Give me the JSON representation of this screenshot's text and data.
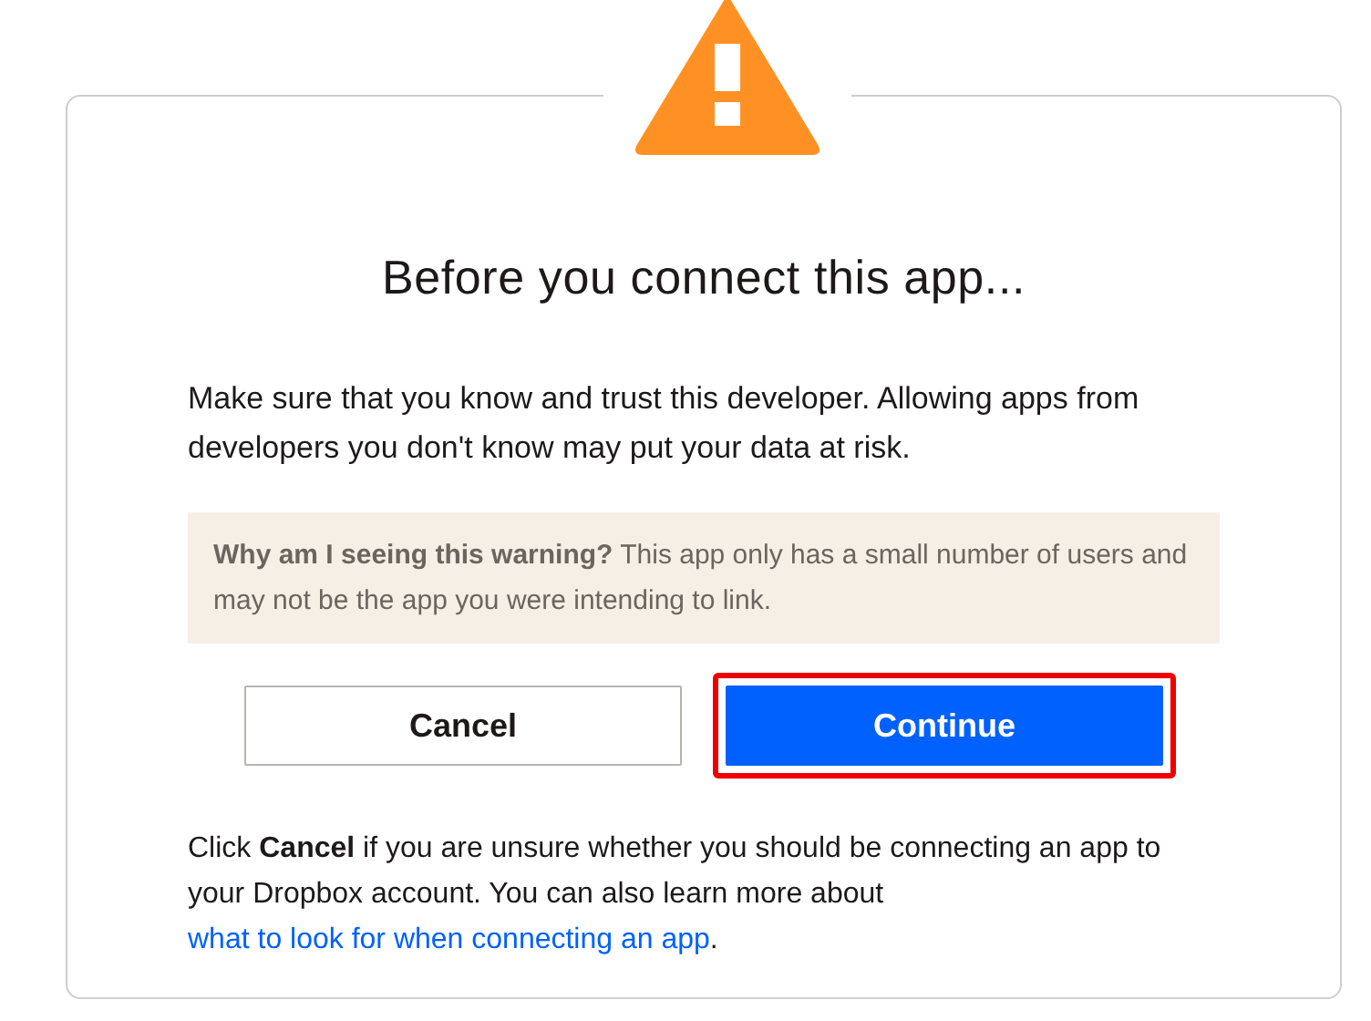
{
  "dialog": {
    "title": "Before you connect this app...",
    "message": "Make sure that you know and trust this developer. Allowing apps from developers you don't know may put your data at risk.",
    "notice": {
      "question": "Why am I seeing this warning?",
      "text": "This app only has a small number of users and may not be the app you were intending to link."
    },
    "buttons": [
      {
        "label": "Cancel",
        "kind": "secondary",
        "highlighted": false
      },
      {
        "label": "Continue",
        "kind": "primary",
        "highlighted": true
      }
    ],
    "footer": {
      "text": "Click **Cancel** if you are unsure whether you should be connecting an app to your Dropbox account. You can also learn more about",
      "link": "what to look for when connecting an app",
      "end": "."
    }
  }
}
